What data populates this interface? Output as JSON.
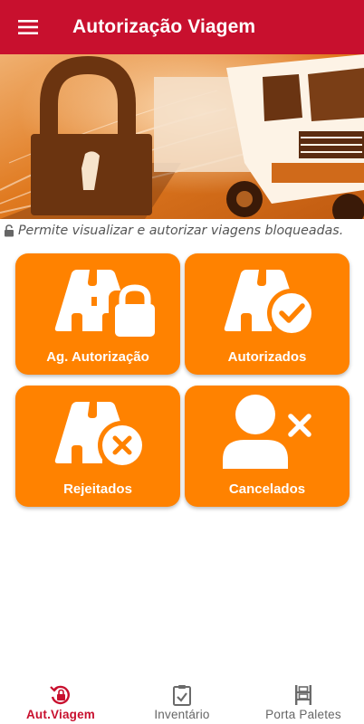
{
  "appbar": {
    "title": "Autorização Viagem",
    "menu_icon": "hamburger-menu-icon",
    "color": "#c8102e"
  },
  "banner": {
    "description_icon": "padlock-icon",
    "tint": "#e87d1e"
  },
  "caption": {
    "icon": "lock-open-icon",
    "text": "Permite visualizar e autorizar viagens bloqueadas."
  },
  "cards": [
    {
      "label": "Ag. Autorização",
      "icon": "road-lock-icon"
    },
    {
      "label": "Autorizados",
      "icon": "road-check-icon"
    },
    {
      "label": "Rejeitados",
      "icon": "road-x-icon"
    },
    {
      "label": "Cancelados",
      "icon": "user-x-icon"
    }
  ],
  "card_color": "#ff8200",
  "bottom_nav": {
    "items": [
      {
        "label": "Aut.Viagem",
        "icon": "lock-refresh-icon",
        "active": true
      },
      {
        "label": "Inventário",
        "icon": "clipboard-check-icon",
        "active": false
      },
      {
        "label": "Porta Paletes",
        "icon": "pallet-rack-icon",
        "active": false
      }
    ]
  }
}
